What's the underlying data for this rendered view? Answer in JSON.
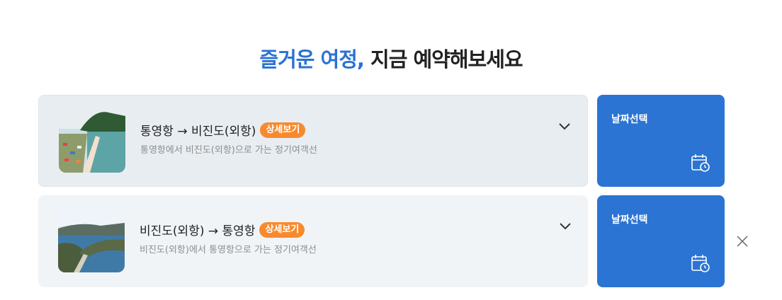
{
  "headline": {
    "accent": "즐거운 여정,",
    "rest": "지금 예약해보세요"
  },
  "routes": [
    {
      "title": "통영항 → 비진도(외항)",
      "badge": "상세보기",
      "description": "통영항에서 비진도(외항)으로 가는 정기여객선",
      "date_button": "날짜선택"
    },
    {
      "title": "비진도(외항) → 통영항",
      "badge": "상세보기",
      "description": "비진도(외항)에서 통영항으로 가는 정기여객선",
      "date_button": "날짜선택"
    }
  ],
  "icons": {
    "expand": "chevron-down-icon",
    "calendar": "calendar-clock-icon",
    "close": "close-icon"
  },
  "colors": {
    "accent": "#2a72d4",
    "date_button": "#2b74d3",
    "badge": "#f88a2e"
  }
}
